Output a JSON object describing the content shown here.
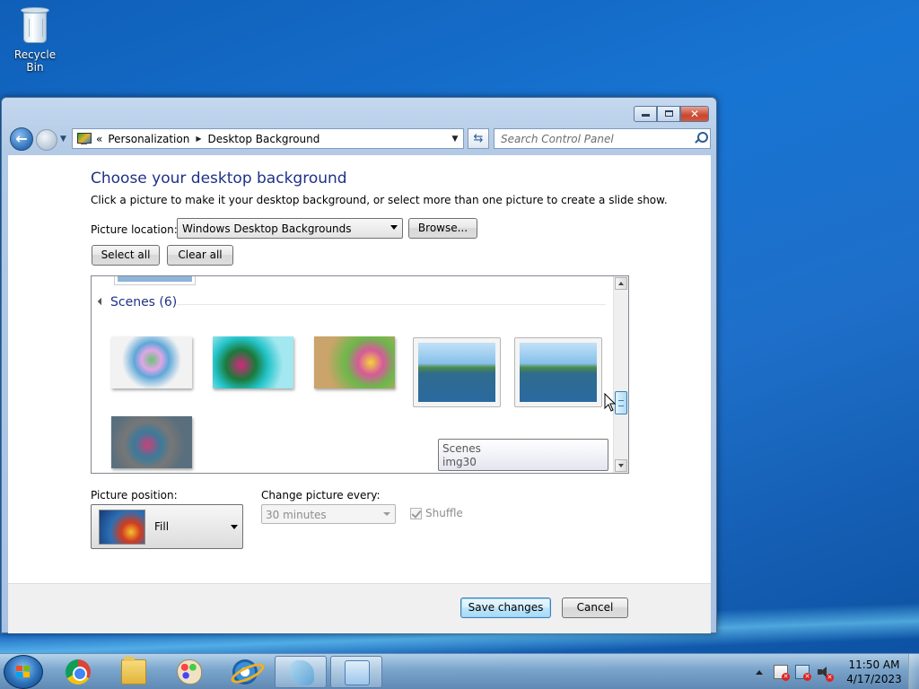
{
  "desktop": {
    "icon_label": "Recycle Bin"
  },
  "window": {
    "nav": {
      "breadcrumb": [
        "Personalization",
        "Desktop Background"
      ],
      "overflow_chevron": "«",
      "search_placeholder": "Search Control Panel"
    },
    "title": "Choose your desktop background",
    "description": "Click a picture to make it your desktop background, or select more than one picture to create a slide show.",
    "picture_location": {
      "label": "Picture location:",
      "value": "Windows Desktop Backgrounds",
      "browse_label": "Browse..."
    },
    "select_all_label": "Select all",
    "clear_all_label": "Clear all",
    "gallery": {
      "group_title": "Scenes (6)",
      "thumbnails": [
        "scene-1",
        "scene-2",
        "scene-3",
        "scene-4",
        "scene-5",
        "scene-6"
      ],
      "tooltip": {
        "line1": "Scenes",
        "line2": "img30"
      }
    },
    "picture_position": {
      "label": "Picture position:",
      "value": "Fill"
    },
    "change_every": {
      "label": "Change picture every:",
      "value": "30 minutes"
    },
    "shuffle_label": "Shuffle",
    "save_label": "Save changes",
    "cancel_label": "Cancel"
  },
  "taskbar": {
    "clock_time": "11:50 AM",
    "clock_date": "4/17/2023",
    "pinned": [
      "Google Chrome",
      "Windows Explorer",
      "Paint",
      "Internet Explorer",
      "Dolphin",
      "Control Panel"
    ]
  },
  "colors": {
    "heading": "#1e3287",
    "accent": "#3c7fb1"
  }
}
